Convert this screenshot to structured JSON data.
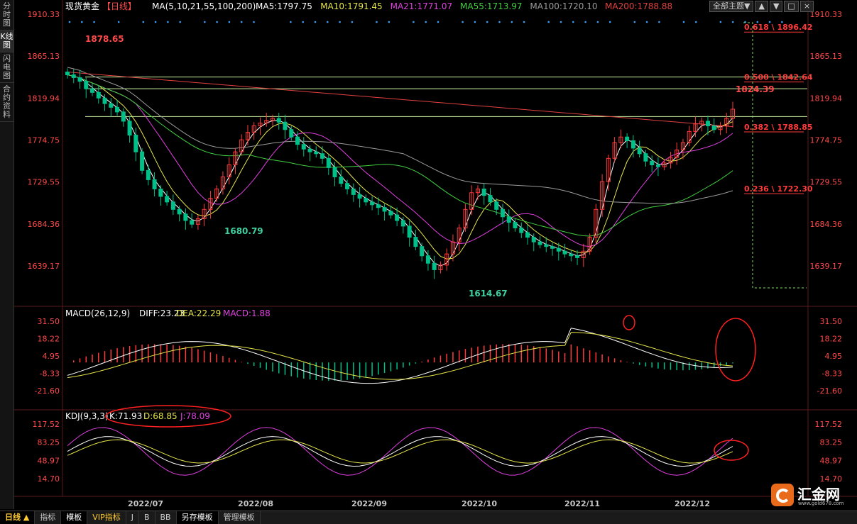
{
  "left_tabs": [
    "分时图",
    "K线图",
    "闪电图",
    "合约资料"
  ],
  "title": {
    "name": "现货黄金",
    "period_tag": "【日线】",
    "ma_label": "MA(5,10,21,55,100,200)",
    "ma_values": [
      {
        "text": "MA5:1797.75",
        "color": "#ffffff"
      },
      {
        "text": "MA10:1791.45",
        "color": "#e6e64a"
      },
      {
        "text": "MA21:1771.07",
        "color": "#e040e0"
      },
      {
        "text": "MA55:1713.97",
        "color": "#40d040"
      },
      {
        "text": "MA100:1720.10",
        "color": "#9a9a9a"
      },
      {
        "text": "MA200:1788.88",
        "color": "#e04040"
      }
    ]
  },
  "top_buttons": {
    "theme": "全部主题▼",
    "b1": "▲",
    "b2": "▼",
    "b3": "□",
    "b4": "×"
  },
  "price_axis_labels": [
    "1910.33",
    "1865.13",
    "1819.94",
    "1774.75",
    "1729.55",
    "1684.36",
    "1639.17"
  ],
  "macd_header": {
    "name": "MACD(26,12,9)",
    "diff": "DIFF:23.23",
    "dea": "DEA:22.29",
    "macd": "MACD:1.88"
  },
  "macd_axis_labels": [
    "31.50",
    "18.22",
    "4.95",
    "-8.33",
    "-21.60"
  ],
  "kdj_header": {
    "name": "KDJ(9,3,3)",
    "k": "K:71.93",
    "d": "D:68.85",
    "j": "J:78.09"
  },
  "kdj_axis_labels": [
    "117.52",
    "83.25",
    "48.97",
    "14.70"
  ],
  "x_axis_labels": [
    "2022/07",
    "2022/08",
    "2022/09",
    "2022/10",
    "2022/11",
    "2022/12"
  ],
  "fib_labels": [
    {
      "text": "0.618 \\ 1896.42",
      "value": 1896.42
    },
    {
      "text": "0.500 \\ 1842.64",
      "value": 1842.64
    },
    {
      "text": "0.382 \\ 1788.85",
      "value": 1788.85
    },
    {
      "text": "0.236 \\ 1722.30",
      "value": 1722.3
    }
  ],
  "price_annotations": [
    {
      "text": "1878.65",
      "value": 1878.65,
      "color": "#ff4a4a"
    },
    {
      "text": "1680.79",
      "value": 1680.79,
      "color": "#40d0a0"
    },
    {
      "text": "1614.67",
      "value": 1614.67,
      "color": "#40d0a0"
    },
    {
      "text": "1824.39",
      "value": 1824.39,
      "color": "#ff4a4a"
    }
  ],
  "bottom_tabs": [
    "日线 ▲",
    "指标",
    "模板",
    "VIP指标",
    "J",
    "B",
    "BB",
    "另存模板",
    "管理模板"
  ],
  "logo": {
    "brand": "汇金网",
    "url": "www.gold678.com"
  },
  "colors": {
    "up": "#ff3b3b",
    "down": "#00c08a",
    "axis": "#ff4a4a",
    "grid": "#3a1a1a",
    "bg": "#000000"
  },
  "chart_data": [
    {
      "type": "candlestick",
      "title": "现货黄金【日线】",
      "x_range": [
        "2022-06",
        "2022-12"
      ],
      "ylim": [
        1614.67,
        1910.33
      ],
      "key_points": {
        "high_start": 1878.65,
        "low_jul": 1680.79,
        "low_sep": 1614.67,
        "high_dec": 1824.39
      },
      "close_path": [
        1845,
        1842,
        1838,
        1830,
        1826,
        1820,
        1814,
        1810,
        1805,
        1795,
        1780,
        1762,
        1742,
        1732,
        1722,
        1714,
        1708,
        1700,
        1695,
        1688,
        1684,
        1690,
        1700,
        1712,
        1722,
        1735,
        1748,
        1762,
        1775,
        1783,
        1790,
        1793,
        1796,
        1798,
        1794,
        1786,
        1778,
        1770,
        1765,
        1762,
        1760,
        1755,
        1745,
        1735,
        1728,
        1722,
        1716,
        1712,
        1708,
        1705,
        1702,
        1698,
        1694,
        1688,
        1682,
        1670,
        1660,
        1650,
        1642,
        1635,
        1640,
        1652,
        1665,
        1680,
        1700,
        1718,
        1722,
        1715,
        1708,
        1700,
        1692,
        1686,
        1680,
        1675,
        1670,
        1665,
        1662,
        1660,
        1658,
        1655,
        1652,
        1650,
        1648,
        1655,
        1670,
        1700,
        1730,
        1755,
        1772,
        1778,
        1774,
        1766,
        1760,
        1752,
        1748,
        1746,
        1750,
        1756,
        1764,
        1772,
        1784,
        1792,
        1795,
        1790,
        1786,
        1790,
        1798,
        1808
      ],
      "moving_averages": [
        "MA5",
        "MA10",
        "MA21",
        "MA55",
        "MA100",
        "MA200"
      ]
    },
    {
      "type": "bar",
      "title": "MACD(26,12,9)",
      "ylim": [
        -21.6,
        31.5
      ],
      "series": [
        {
          "name": "DIFF"
        },
        {
          "name": "DEA"
        },
        {
          "name": "MACD"
        }
      ],
      "latest": {
        "DIFF": 23.23,
        "DEA": 22.29,
        "MACD": 1.88
      }
    },
    {
      "type": "line",
      "title": "KDJ(9,3,3)",
      "ylim": [
        14.7,
        117.52
      ],
      "series": [
        {
          "name": "K"
        },
        {
          "name": "D"
        },
        {
          "name": "J"
        }
      ],
      "latest": {
        "K": 71.93,
        "D": 68.85,
        "J": 78.09
      }
    }
  ]
}
